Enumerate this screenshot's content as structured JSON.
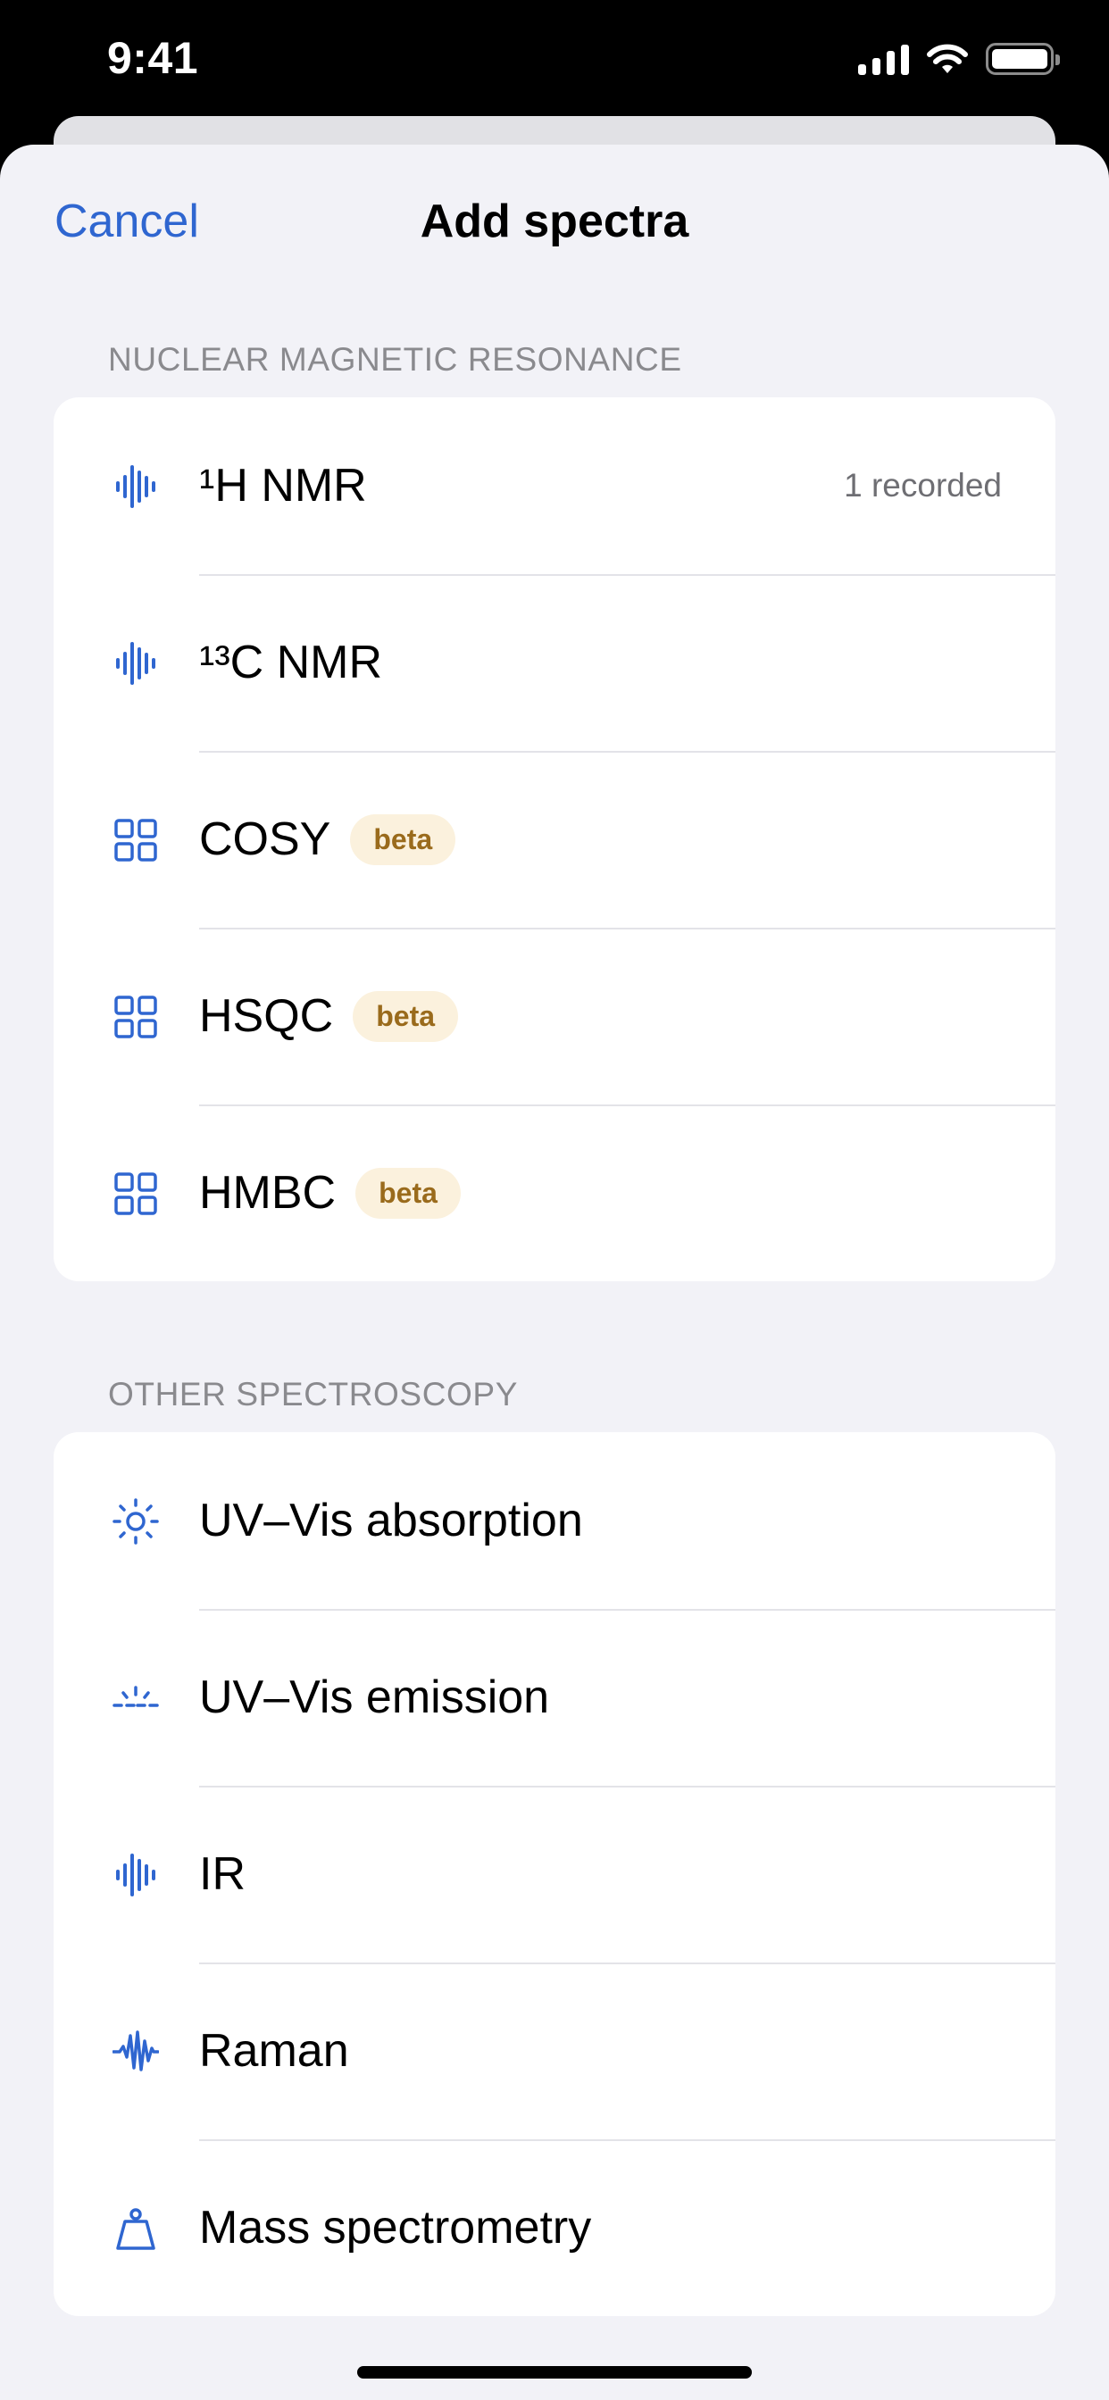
{
  "status_bar": {
    "time": "9:41"
  },
  "nav": {
    "cancel_label": "Cancel",
    "title": "Add spectra"
  },
  "accent_color": "#2f66d0",
  "sections": [
    {
      "header": "NUCLEAR MAGNETIC RESONANCE",
      "rows": [
        {
          "icon": "waveform-icon",
          "label": "¹H NMR",
          "detail": "1 recorded"
        },
        {
          "icon": "waveform-icon",
          "label": "¹³C NMR"
        },
        {
          "icon": "grid-icon",
          "label": "COSY",
          "badge": "beta"
        },
        {
          "icon": "grid-icon",
          "label": "HSQC",
          "badge": "beta"
        },
        {
          "icon": "grid-icon",
          "label": "HMBC",
          "badge": "beta"
        }
      ]
    },
    {
      "header": "OTHER SPECTROSCOPY",
      "rows": [
        {
          "icon": "sun-icon",
          "label": "UV–Vis absorption"
        },
        {
          "icon": "sun-horizon-icon",
          "label": "UV–Vis emission"
        },
        {
          "icon": "waveform-icon",
          "label": "IR"
        },
        {
          "icon": "waveform-path-icon",
          "label": "Raman"
        },
        {
          "icon": "scale-weight-icon",
          "label": "Mass spectrometry"
        }
      ]
    }
  ]
}
